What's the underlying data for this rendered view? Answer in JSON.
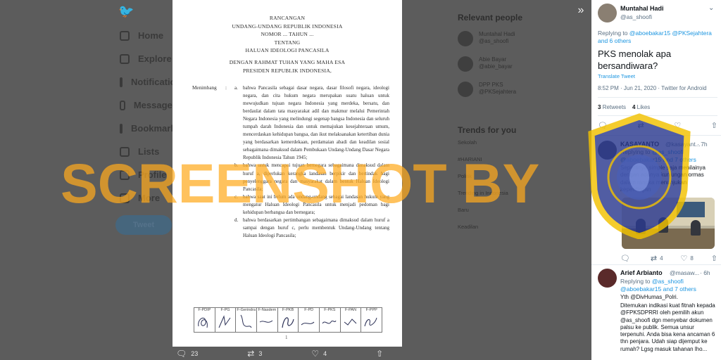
{
  "background": {
    "nav": [
      "Home",
      "Explore",
      "Notifications",
      "Messages",
      "Bookmarks",
      "Lists",
      "Profile",
      "More"
    ],
    "tweet_button": "Tweet",
    "relevant_people_title": "Relevant people",
    "relevant_people": [
      {
        "name": "Muntahal Hadi",
        "handle": "@as_shoofi"
      },
      {
        "name": "Abie Bayar",
        "handle": "@abie_bayar"
      },
      {
        "name": "DPP PKS",
        "handle": "@PKSejahtera"
      }
    ],
    "trends_title": "Trends for you",
    "trends": [
      "Sekolah",
      "#HARIANI",
      "Politik",
      "Trending in Indonesia",
      "Baru",
      "Keadilan"
    ]
  },
  "document": {
    "title_lines": [
      "RANCANGAN",
      "UNDANG-UNDANG REPUBLIK INDONESIA",
      "NOMOR ... TAHUN ...",
      "TENTANG",
      "HALUAN IDEOLOGI PANCASILA"
    ],
    "preamble_lines": [
      "DENGAN RAHMAT TUHAN YANG MAHA ESA",
      "PRESIDEN REPUBLIK INDONESIA,"
    ],
    "menimbang_label": "Menimbang",
    "clauses": [
      {
        "letter": "a.",
        "text": "bahwa Pancasila sebagai dasar negara, dasar filosofi negara, ideologi negara, dan cita hukum negara merupakan suatu haluan untuk mewujudkan tujuan negara Indonesia yang merdeka, bersatu, dan berdaulat dalam tata masyarakat adil dan makmur melalui Pemerintah Negara Indonesia yang melindungi segenap bangsa Indonesia dan seluruh tumpah darah Indonesia dan untuk memajukan kesejahteraan umum, mencerdaskan kehidupan bangsa, dan ikut melaksanakan ketertiban dunia yang berdasarkan kemerdekaan, perdamaian abadi dan keadilan sosial sebagaimana dimaksud dalam Pembukaan Undang-Undang Dasar Negara Republik Indonesia Tahun 1945;"
      },
      {
        "letter": "b.",
        "text": "bahwa untuk mencapai tujuan bernegara sebagaimana dimaksud dalam huruf a, diperlukan kerangka landasan berpikir dan bertindak bagi penyelenggara negara dan masyarakat dalam bentuk Haluan Ideologi Pancasila;"
      },
      {
        "letter": "c.",
        "text": "bahwa saat ini belum ada undang-undang sebagai landasan hukum yang mengatur Haluan Ideologi Pancasila untuk menjadi pedoman bagi kehidupan berbangsa dan bernegara;"
      },
      {
        "letter": "d.",
        "text": "bahwa berdasarkan pertimbangan sebagaimana dimaksud dalam huruf a sampai dengan huruf c, perlu membentuk Undang-Undang tentang Haluan Ideologi Pancasila;"
      }
    ],
    "signature_columns": [
      "F-PDIP",
      "F-PG",
      "F-Gerindra",
      "F-Nasdem",
      "F-PKB",
      "F-PD",
      "F-PKS",
      "F-PAN",
      "F-PPP"
    ],
    "page_number": "1"
  },
  "media_actions": {
    "replies": "23",
    "retweets": "3",
    "likes": "4"
  },
  "watermark_text": "SCREENSHOT BY",
  "main_tweet": {
    "name": "Muntahal Hadi",
    "handle": "@as_shoofi",
    "replying_prefix": "Replying to",
    "replying_users": "@aboebakar15 @PKSejahtera",
    "replying_others": "and 6 others",
    "text": "PKS menolak apa bersandiwara?",
    "translate": "Translate Tweet",
    "time": "8:52 PM · Jun 21, 2020 · Twitter for Android",
    "retweets_count": "3",
    "retweets_label": "Retweets",
    "likes_count": "4",
    "likes_label": "Likes"
  },
  "replies": [
    {
      "name": "KASAYANTO",
      "handle": "@kasayant...",
      "time": "· 7h",
      "replying_prefix": "Replying to",
      "replying_users": "@as_shoofi",
      "replying_line2": "@aboebakar15 and 7 others",
      "text": "Sepertinya simple saja menilainya dengan adanya kunjungan ormas dalam rangka menunjukan kepentingan",
      "reply_count": "",
      "retweet_count": "4",
      "like_count": "8"
    },
    {
      "name": "Arief Arbianto",
      "handle": "@masaw...",
      "time": "· 6h",
      "replying_prefix": "Replying to",
      "replying_users": "@as_shoofi",
      "replying_line2": "@aboebakar15 and 7 others",
      "yth": "Yth @DivHumas_Polri.",
      "text": "Ditemukan indikasi kuat fitnah kepada @FPKSDPRRI oleh pemilih akun @as_shoofi dgn menyebar dokumen palsu ke publik. Semua unsur terpenuhi. Anda bisa kena ancaman 6 thn penjara. Udah siap dijemput ke rumah? Lgsg masuk tahanan lho..."
    }
  ],
  "colors": {
    "link": "#1b95e0",
    "watermark": "#ffaa1e",
    "seal_blue": "#2b3a8f",
    "seal_gold": "#f2c200"
  }
}
